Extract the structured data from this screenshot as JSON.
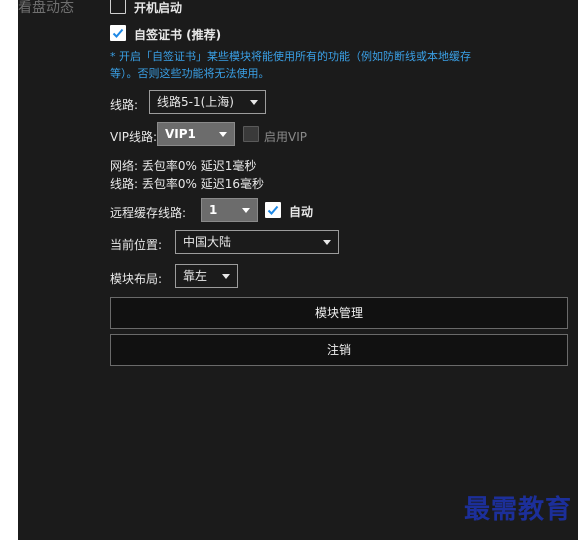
{
  "section": {
    "label": "看盘动态"
  },
  "autostart": {
    "label": "开机启动",
    "checked": false
  },
  "self_cert": {
    "label": "自签证书 (推荐)",
    "checked": true
  },
  "note": {
    "line1": "* 开启「自签证书」某些模块将能使用所有的功能（例如防断线或本地缓存",
    "line2": "等）。否则这些功能将无法使用。"
  },
  "route": {
    "label": "线路:",
    "value": "线路5-1(上海)"
  },
  "vip_route": {
    "label": "VIP线路:",
    "value": "VIP1",
    "enable_label": "启用VIP",
    "enabled": false
  },
  "stats": {
    "network": "网络: 丢包率0% 延迟1毫秒",
    "route": "线路: 丢包率0% 延迟16毫秒"
  },
  "remote_cache": {
    "label": "远程缓存线路:",
    "value": "1",
    "auto_label": "自动",
    "auto": true
  },
  "location": {
    "label": "当前位置:",
    "value": "中国大陆"
  },
  "layout": {
    "label": "模块布局:",
    "value": "靠左"
  },
  "buttons": {
    "module_manage": "模块管理",
    "logout": "注销"
  },
  "watermark": "最需教育",
  "colors": {
    "panel_bg": "#1b1b1b",
    "note_blue": "#3aa0e6",
    "check_blue": "#1e88e5",
    "watermark": "#1c2f9a"
  }
}
